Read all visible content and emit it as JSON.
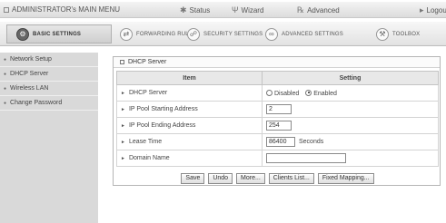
{
  "topbar": {
    "title": "ADMINISTRATOR's MAIN MENU",
    "items": [
      {
        "label": "Status",
        "icon": "status-icon"
      },
      {
        "label": "Wizard",
        "icon": "wizard-icon"
      },
      {
        "label": "Advanced",
        "icon": "advanced-icon"
      },
      {
        "label": "Logout",
        "icon": "logout-icon"
      }
    ]
  },
  "tabs": [
    {
      "label": "BASIC SETTINGS",
      "active": true
    },
    {
      "label": "FORWARDING RULES",
      "active": false
    },
    {
      "label": "SECURITY SETTINGS",
      "active": false
    },
    {
      "label": "ADVANCED SETTINGS",
      "active": false
    },
    {
      "label": "TOOLBOX",
      "active": false
    }
  ],
  "sidebar": {
    "items": [
      {
        "label": "Network Setup"
      },
      {
        "label": "DHCP Server"
      },
      {
        "label": "Wireless LAN"
      },
      {
        "label": "Change Password"
      }
    ]
  },
  "panel": {
    "title": "DHCP Server",
    "headers": {
      "item": "Item",
      "setting": "Setting"
    },
    "rows": {
      "dhcp_server": {
        "label": "DHCP Server",
        "options": [
          "Disabled",
          "Enabled"
        ],
        "selected": "Enabled"
      },
      "pool_start": {
        "label": "IP Pool Starting Address",
        "value": "2"
      },
      "pool_end": {
        "label": "IP Pool Ending Address",
        "value": "254"
      },
      "lease_time": {
        "label": "Lease Time",
        "value": "86400",
        "unit": "Seconds"
      },
      "domain": {
        "label": "Domain Name",
        "value": ""
      }
    },
    "buttons": {
      "save": "Save",
      "undo": "Undo",
      "more": "More...",
      "clients": "Clients List...",
      "fixed": "Fixed Mapping..."
    }
  }
}
